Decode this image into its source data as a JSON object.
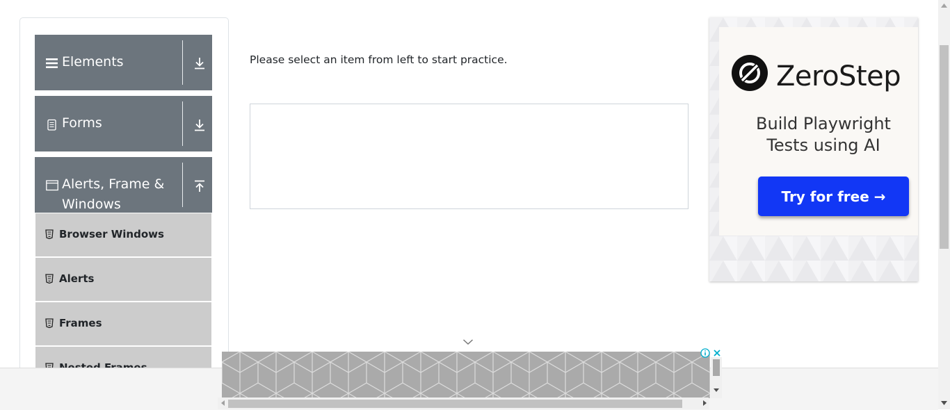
{
  "sidebar": {
    "groups": [
      {
        "label": "Elements",
        "icon": "hamburger-icon",
        "toggle": "download-arrow-icon"
      },
      {
        "label": "Forms",
        "icon": "document-icon",
        "toggle": "download-arrow-icon"
      },
      {
        "label": "Alerts, Frame &",
        "label_line2": "Windows",
        "icon": "window-icon",
        "toggle": "upload-arrow-icon"
      }
    ],
    "items": [
      {
        "label": "Browser Windows",
        "icon": "html5-icon"
      },
      {
        "label": "Alerts",
        "icon": "html5-icon"
      },
      {
        "label": "Frames",
        "icon": "html5-icon"
      },
      {
        "label": "Nested Frames",
        "icon": "html5-icon"
      }
    ]
  },
  "main": {
    "instruction": "Please select an item from left to start practice."
  },
  "ad": {
    "brand": "ZeroStep",
    "headline_line1": "Build Playwright",
    "headline_line2": "Tests using AI",
    "cta": "Try for free →",
    "cta_color": "#1237f5"
  },
  "colors": {
    "group_header_bg": "#6c757d",
    "sub_item_bg": "#cccccc"
  }
}
